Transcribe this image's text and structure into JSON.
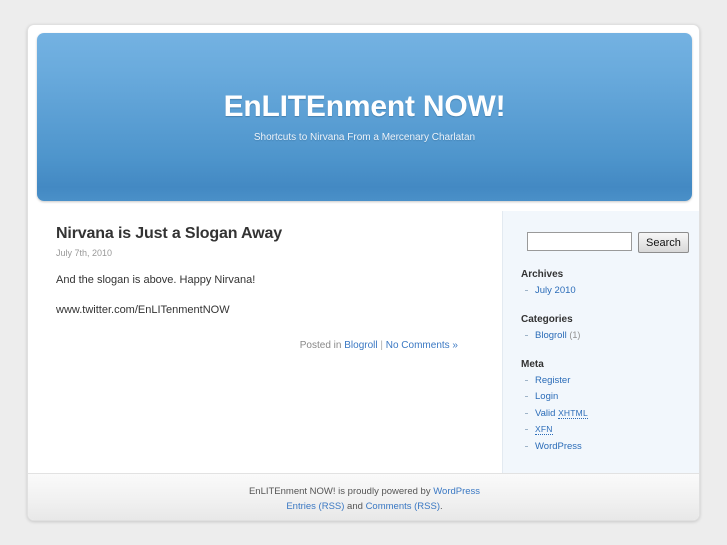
{
  "site": {
    "title": "EnLITEnment NOW!",
    "description": "Shortcuts to Nirvana From a Mercenary Charlatan"
  },
  "post": {
    "title": "Nirvana is Just a Slogan Away",
    "date": "July 7th, 2010",
    "paragraph_1": "And the slogan is above. Happy Nirvana!",
    "paragraph_2": "www.twitter.com/EnLITenmentNOW",
    "meta_prefix": "Posted in ",
    "category_link": "Blogroll",
    "meta_separator": " | ",
    "comments_link": "No Comments »"
  },
  "sidebar": {
    "search": {
      "value": "",
      "placeholder": "",
      "button_label": "Search"
    },
    "widgets": [
      {
        "title": "Archives",
        "items": [
          {
            "label": "July 2010",
            "count": ""
          }
        ]
      },
      {
        "title": "Categories",
        "items": [
          {
            "label": "Blogroll",
            "count": "(1)"
          }
        ]
      },
      {
        "title": "Meta",
        "items": [
          {
            "label": "Register",
            "count": ""
          },
          {
            "label": "Login",
            "count": ""
          },
          {
            "label": "Valid",
            "abbrev": "XHTML",
            "count": ""
          },
          {
            "label": "",
            "abbrev": "XFN",
            "count": ""
          },
          {
            "label": "WordPress",
            "count": ""
          }
        ]
      }
    ]
  },
  "footer": {
    "line1_prefix": "EnLITEnment NOW! is proudly powered by ",
    "line1_link": "WordPress",
    "line2_link1": "Entries (RSS)",
    "line2_mid": " and ",
    "line2_link2": "Comments (RSS)",
    "line2_suffix": "."
  },
  "colors": {
    "header_top": "#74b2e2",
    "header_bottom": "#4389c3",
    "link": "#3a78c3",
    "sidebar_bg": "#f2f7fc",
    "page_bg": "#ededed"
  }
}
